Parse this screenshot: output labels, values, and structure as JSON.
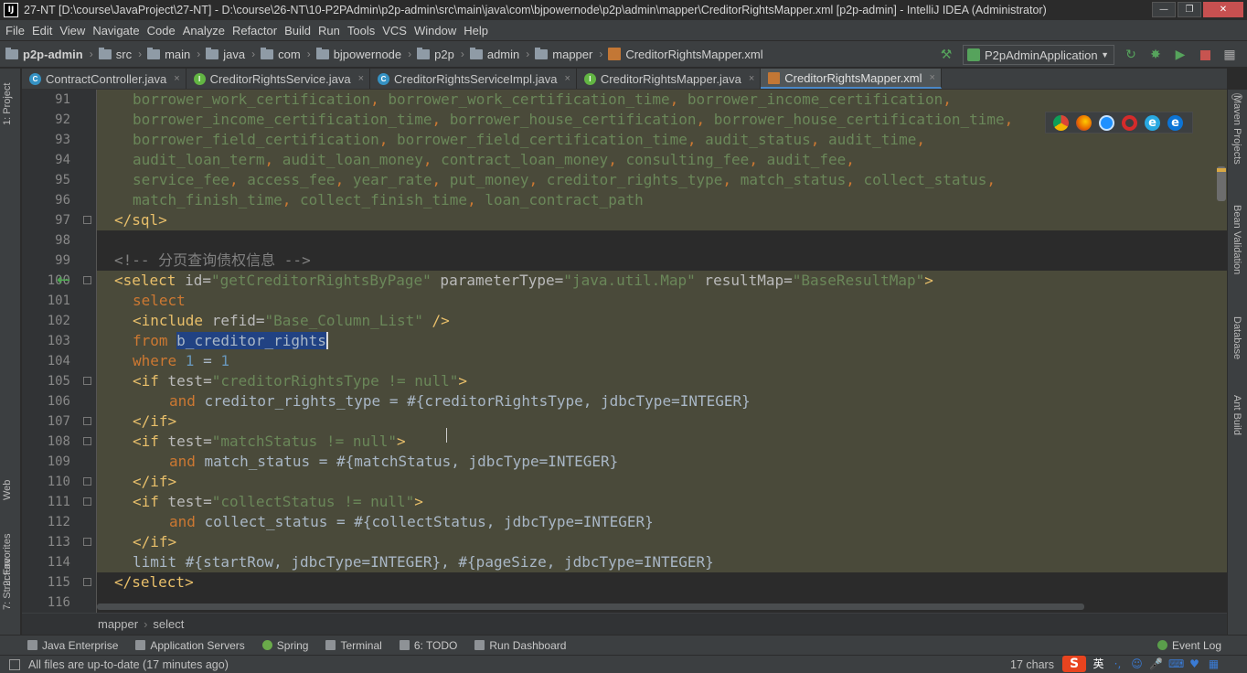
{
  "title": "27-NT [D:\\course\\JavaProject\\27-NT] - D:\\course\\26-NT\\10-P2PAdmin\\p2p-admin\\src\\main\\java\\com\\bjpowernode\\p2p\\admin\\mapper\\CreditorRightsMapper.xml [p2p-admin] - IntelliJ IDEA (Administrator)",
  "menu": [
    "File",
    "Edit",
    "View",
    "Navigate",
    "Code",
    "Analyze",
    "Refactor",
    "Build",
    "Run",
    "Tools",
    "VCS",
    "Window",
    "Help"
  ],
  "nav": {
    "crumbs": [
      "p2p-admin",
      "src",
      "main",
      "java",
      "com",
      "bjpowernode",
      "p2p",
      "admin",
      "mapper",
      "CreditorRightsMapper.xml"
    ],
    "run_config": "P2pAdminApplication"
  },
  "tabs": [
    {
      "label": "ContractController.java",
      "icon": "C"
    },
    {
      "label": "CreditorRightsService.java",
      "icon": "I"
    },
    {
      "label": "CreditorRightsServiceImpl.java",
      "icon": "C"
    },
    {
      "label": "CreditorRightsMapper.java",
      "icon": "I"
    },
    {
      "label": "CreditorRightsMapper.xml",
      "icon": "xml",
      "active": true
    }
  ],
  "left_tools": [
    "1: Project",
    "Web",
    "2: Favorites",
    "7: Structure"
  ],
  "right_tools": [
    "Maven Projects",
    "Bean Validation",
    "Database",
    "Ant Build"
  ],
  "line_numbers": [
    "91",
    "92",
    "93",
    "94",
    "95",
    "96",
    "97",
    "98",
    "99",
    "100",
    "101",
    "102",
    "103",
    "104",
    "105",
    "106",
    "107",
    "108",
    "109",
    "110",
    "111",
    "112",
    "113",
    "114",
    "115",
    "116"
  ],
  "breadcrumb": [
    "mapper",
    "select"
  ],
  "tool_windows": [
    "Java Enterprise",
    "Application Servers",
    "Spring",
    "Terminal",
    "6: TODO",
    "Run Dashboard"
  ],
  "event_log": "Event Log",
  "status": {
    "message": "All files are up-to-date (17 minutes ago)",
    "chars": "17 chars",
    "ime_label": "英"
  },
  "browsers": [
    "chrome-icon",
    "firefox-icon",
    "safari-icon",
    "opera-icon",
    "ie-icon",
    "edge-icon"
  ],
  "code": {
    "l91": [
      "borrower_work_certification",
      "borrower_work_certification_time",
      "borrower_income_certification"
    ],
    "l92": [
      "borrower_income_certification_time",
      "borrower_house_certification",
      "borrower_house_certification_time"
    ],
    "l93": [
      "borrower_field_certification",
      "borrower_field_certification_time",
      "audit_status",
      "audit_time"
    ],
    "l94": [
      "audit_loan_term",
      "audit_loan_money",
      "contract_loan_money",
      "consulting_fee",
      "audit_fee"
    ],
    "l95": [
      "service_fee",
      "access_fee",
      "year_rate",
      "put_money",
      "creditor_rights_type",
      "match_status",
      "collect_status"
    ],
    "l96": [
      "match_finish_time",
      "collect_finish_time",
      "loan_contract_path"
    ],
    "l97_tag": "</sql>",
    "l99_comment": "<!-- 分页查询债权信息 -->",
    "l100": {
      "open": "<select ",
      "id_attr": "id=",
      "id_val": "\"getCreditorRightsByPage\"",
      "pt_attr": " parameterType=",
      "pt_val": "\"java.util.Map\"",
      "rm_attr": " resultMap=",
      "rm_val": "\"BaseResultMap\"",
      "close": ">"
    },
    "l101": "select",
    "l102": {
      "open": "<include ",
      "attr": "refid=",
      "val": "\"Base_Column_List\"",
      "close": " />"
    },
    "l103": {
      "kw": "from ",
      "selected": "b_creditor_rights"
    },
    "l104": {
      "kw": "where ",
      "n1": "1",
      "eq": " = ",
      "n2": "1"
    },
    "l105": {
      "open": "<if ",
      "attr": "test=",
      "val": "\"creditorRightsType != null\"",
      "close": ">"
    },
    "l106": {
      "kw": "and ",
      "text": "creditor_rights_type = #{creditorRightsType, jdbcType=INTEGER}"
    },
    "l107": "</if>",
    "l108": {
      "open": "<if ",
      "attr": "test=",
      "val": "\"matchStatus != null\"",
      "close": ">"
    },
    "l109": {
      "kw": "and ",
      "text": "match_status = #{matchStatus, jdbcType=INTEGER}"
    },
    "l110": "</if>",
    "l111": {
      "open": "<if ",
      "attr": "test=",
      "val": "\"collectStatus != null\"",
      "close": ">"
    },
    "l112": {
      "kw": "and ",
      "text": "collect_status = #{collectStatus, jdbcType=INTEGER}"
    },
    "l113": "</if>",
    "l114": "limit #{startRow, jdbcType=INTEGER}, #{pageSize, jdbcType=INTEGER}",
    "l115": "</select>"
  }
}
